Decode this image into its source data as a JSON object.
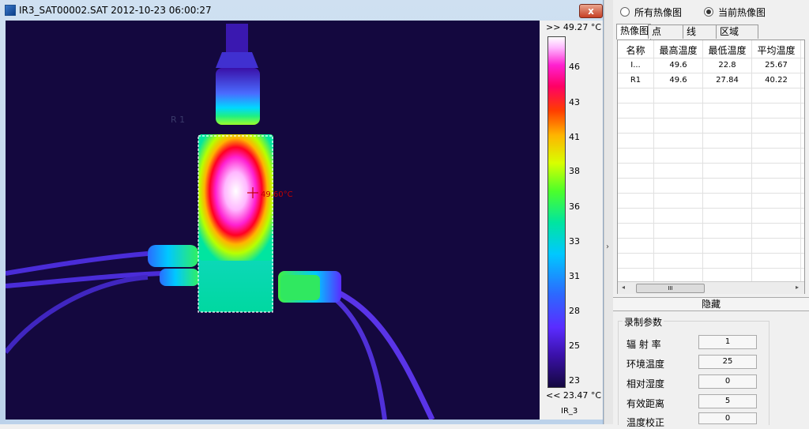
{
  "window": {
    "title": "IR3_SAT00002.SAT 2012-10-23 06:00:27",
    "close_label": "x"
  },
  "thermal": {
    "roi_label": "R 1",
    "cursor_temp": "49.60°C"
  },
  "scale": {
    "max_label": ">> 49.27 °C",
    "min_label": "<< 23.47 °C",
    "ticks": [
      "46",
      "43",
      "41",
      "38",
      "36",
      "33",
      "31",
      "28",
      "25",
      "23"
    ],
    "name": "IR_3"
  },
  "radios": {
    "all": "所有热像图",
    "current": "当前热像图",
    "selected": "current"
  },
  "tabs": [
    "热像图",
    "点",
    "线",
    "区域"
  ],
  "table": {
    "headers": [
      "名称",
      "最高温度",
      "最低温度",
      "平均温度"
    ],
    "rows": [
      [
        "I...",
        "49.6",
        "22.8",
        "25.67"
      ],
      [
        "R1",
        "49.6",
        "27.84",
        "40.22"
      ]
    ],
    "scroll_thumb": "III"
  },
  "hide_label": "隐藏",
  "params": {
    "title": "录制参数",
    "items": [
      {
        "label": "辐 射 率",
        "value": "1"
      },
      {
        "label": "环境温度",
        "value": "25"
      },
      {
        "label": "相对湿度",
        "value": "0"
      },
      {
        "label": "有效距离",
        "value": "5"
      },
      {
        "label": "温度校正",
        "value": "0"
      }
    ]
  },
  "colors": {
    "background": "#14083f",
    "hot": "#ffffff",
    "mid": "#00e5a0",
    "warm": "#ff3d00"
  }
}
